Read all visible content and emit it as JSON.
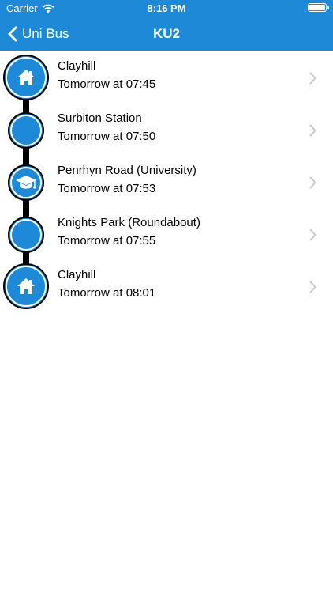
{
  "status_bar": {
    "carrier": "Carrier",
    "time": "8:16 PM"
  },
  "nav": {
    "back_label": "Uni Bus",
    "title": "KU2"
  },
  "colors": {
    "accent": "#1e8ad7",
    "route_line": "#000000",
    "chevron": "#c7c7cc"
  },
  "stops": [
    {
      "name": "Clayhill",
      "time": "Tomorrow at 07:45",
      "icon": "house-icon",
      "marker": "large"
    },
    {
      "name": "Surbiton Station",
      "time": "Tomorrow at 07:50",
      "icon": "none",
      "marker": "small"
    },
    {
      "name": "Penrhyn Road (University)",
      "time": "Tomorrow at 07:53",
      "icon": "graduation-cap-icon",
      "marker": "small"
    },
    {
      "name": "Knights Park (Roundabout)",
      "time": "Tomorrow at 07:55",
      "icon": "none",
      "marker": "small"
    },
    {
      "name": "Clayhill",
      "time": "Tomorrow at 08:01",
      "icon": "house-icon",
      "marker": "large"
    }
  ]
}
